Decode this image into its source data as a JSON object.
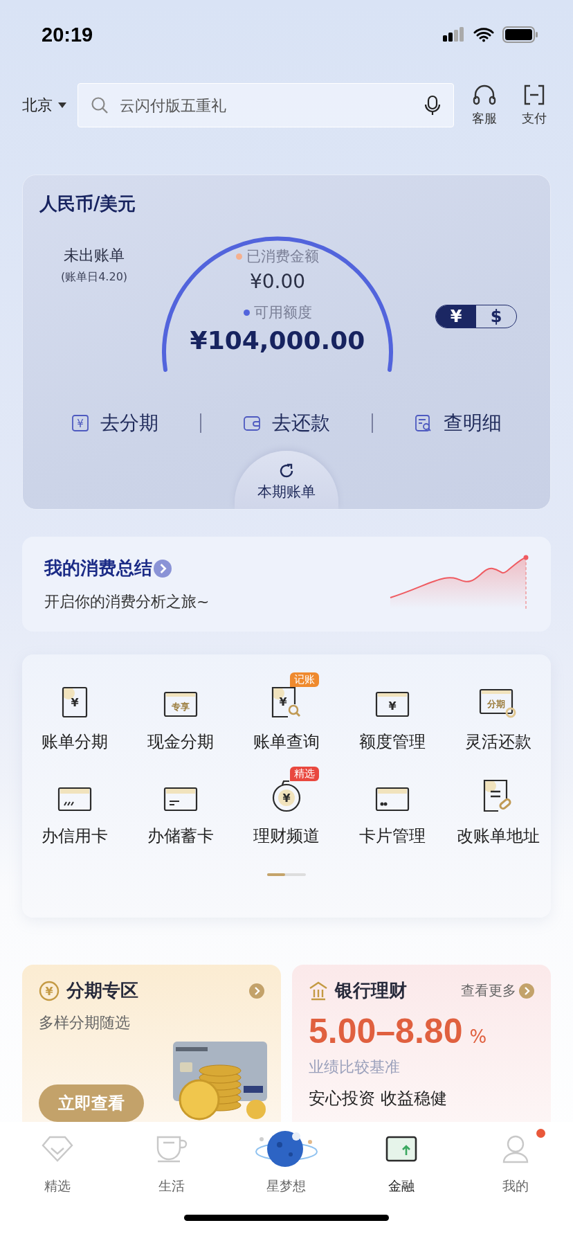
{
  "status_bar": {
    "time": "20:19"
  },
  "header": {
    "city": "北京",
    "search": {
      "placeholder": "云闪付版五重礼"
    },
    "actions": [
      {
        "label": "客服",
        "kind": "headset"
      },
      {
        "label": "支付",
        "kind": "scan"
      }
    ]
  },
  "bill_card": {
    "title": "人民币/美元",
    "bill_status": "未出账单",
    "bill_date": "(账单日4.20)",
    "spent_label": "已消费金额",
    "spent": "¥0.00",
    "available_label": "可用额度",
    "available": "¥104,000.00",
    "currency": [
      {
        "label": "¥",
        "selected": true
      },
      {
        "label": "$",
        "selected": false
      }
    ],
    "actions": [
      {
        "label": "去分期",
        "kind": "installment",
        "icon_text": "¥"
      },
      {
        "label": "去还款",
        "kind": "wallet"
      },
      {
        "label": "查明细",
        "kind": "detail"
      }
    ],
    "current_bill": "本期账单"
  },
  "summary": {
    "title": "我的消费总结",
    "subtitle": "开启你的消费分析之旅~"
  },
  "services": {
    "items": [
      {
        "label": "账单分期",
        "kind": "doc",
        "icon_text": "¥"
      },
      {
        "label": "现金分期",
        "kind": "card",
        "icon_text": "专享"
      },
      {
        "label": "账单查询",
        "kind": "doc-search",
        "icon_text": "¥",
        "badge": "记账",
        "color": "#ef8a2e"
      },
      {
        "label": "额度管理",
        "kind": "card",
        "icon_text": "¥"
      },
      {
        "label": "灵活还款",
        "kind": "card-cycle",
        "icon_text": "分期"
      },
      {
        "label": "办信用卡",
        "kind": "card-stripes"
      },
      {
        "label": "办储蓄卡",
        "kind": "card-lines"
      },
      {
        "label": "理财频道",
        "kind": "coin",
        "icon_text": "¥",
        "badge": "精选",
        "color": "#e9483f"
      },
      {
        "label": "卡片管理",
        "kind": "card-dots"
      },
      {
        "label": "改账单地址",
        "kind": "doc-edit"
      }
    ]
  },
  "promos": {
    "installment": {
      "title": "分期专区",
      "icon_text": "¥",
      "subtitle": "多样分期随选",
      "button": "立即查看"
    },
    "wealth": {
      "title": "银行理财",
      "more": "查看更多",
      "rate": "5.00–8.80",
      "unit": "%",
      "rate_label": "业绩比较基准",
      "slogan": "安心投资 收益稳健"
    }
  },
  "tab_bar": [
    {
      "label": "精选",
      "kind": "diamond",
      "selected": false,
      "dot": false
    },
    {
      "label": "生活",
      "kind": "cup",
      "selected": false,
      "dot": false
    },
    {
      "label": "星梦想",
      "kind": "planet",
      "selected": false,
      "dot": false
    },
    {
      "label": "金融",
      "kind": "finance",
      "selected": true,
      "dot": false
    },
    {
      "label": "我的",
      "kind": "person",
      "selected": false,
      "dot": true
    }
  ]
}
